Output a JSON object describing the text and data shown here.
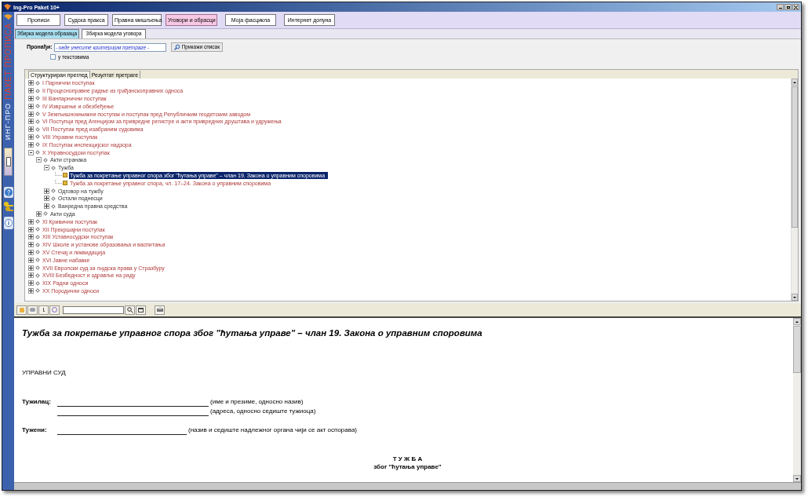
{
  "window": {
    "title": "Ing-Pro Paket 10+"
  },
  "sidebar": {
    "brand_top": "ПАКЕТ ПРОПИСА",
    "brand_bottom": "ИНГ-ПРО"
  },
  "tabs": [
    {
      "label": "Прописи",
      "selected": false
    },
    {
      "label": "Судска пракса",
      "selected": false
    },
    {
      "label": "Правна мишљења",
      "selected": false
    },
    {
      "label": "Уговори и обрасци",
      "selected": true
    },
    {
      "label": "Моја фасцикла",
      "selected": false
    },
    {
      "label": "Интернет допуна",
      "selected": false
    }
  ],
  "subtabs": [
    {
      "label": "Збирка модела образаца",
      "selected": true
    },
    {
      "label": "Збирка модела уговора",
      "selected": false
    }
  ],
  "search": {
    "label": "Пронађи:",
    "placeholder": "- овде унесите критеријум претраге -",
    "button": "Прикажи списак",
    "checkbox_label": "у текстовима",
    "checked": false
  },
  "tree_tabs": [
    {
      "label": "Структуриран преглед",
      "selected": true
    },
    {
      "label": "Резултат претраге",
      "selected": false
    }
  ],
  "tree": [
    {
      "kind": "section",
      "label": "I Парнични поступак",
      "expanded": false,
      "selected": false
    },
    {
      "kind": "section",
      "label": "II  Процесноправне радње из грађанскоправних односа",
      "expanded": false,
      "selected": false
    },
    {
      "kind": "section",
      "label": "III Ванпарнични поступак",
      "expanded": false,
      "selected": false
    },
    {
      "kind": "section",
      "label": "IV Извршење и обезбеђење",
      "expanded": false,
      "selected": false
    },
    {
      "kind": "section",
      "label": "V Земљишнокњижни поступак и поступак пред Републичким геодетским заводом",
      "expanded": false,
      "selected": false
    },
    {
      "kind": "section",
      "label": "VI Поступци пред Агенцијом за привредне регистре и акти привредних друштава и удружења",
      "expanded": false,
      "selected": false
    },
    {
      "kind": "section",
      "label": "VII Поступак пред изабраним судовима",
      "expanded": false,
      "selected": false
    },
    {
      "kind": "section",
      "label": "VIII Управни поступак",
      "expanded": false,
      "selected": false
    },
    {
      "kind": "section",
      "label": "IX Поступак инспекцијског надзора",
      "expanded": false,
      "selected": false
    },
    {
      "kind": "section",
      "label": "X Управносудски поступак",
      "expanded": true,
      "selected": false,
      "children": [
        {
          "kind": "folder",
          "label": "Акти странака",
          "expanded": true,
          "selected": false,
          "children": [
            {
              "kind": "folder",
              "label": "Тужба",
              "expanded": true,
              "selected": false,
              "children": [
                {
                  "kind": "document",
                  "label": "Тужба за покретање управног спора због \"ћутања управе\" – члан 19. Закона о управним споровима",
                  "selected": true
                },
                {
                  "kind": "document",
                  "label": "Тужба за покретање управног спора, чл. 17–24. Закона о управним споровима",
                  "selected": false
                }
              ]
            },
            {
              "kind": "folder",
              "label": "Одговор на тужбу",
              "expanded": false,
              "selected": false
            },
            {
              "kind": "folder",
              "label": "Остали поднесци",
              "expanded": false,
              "selected": false
            },
            {
              "kind": "folder",
              "label": "Ванредна правна средства",
              "expanded": false,
              "selected": false
            }
          ]
        },
        {
          "kind": "folder",
          "label": "Акти суда",
          "expanded": false,
          "selected": false
        }
      ]
    },
    {
      "kind": "section",
      "label": "XI Кривични поступак",
      "expanded": false,
      "selected": false
    },
    {
      "kind": "section",
      "label": "XII Прекршајни поступак",
      "expanded": false,
      "selected": false
    },
    {
      "kind": "section",
      "label": "XIII Уставносудски поступак",
      "expanded": false,
      "selected": false
    },
    {
      "kind": "section",
      "label": "XIV Школе и установе образовања и васпитања",
      "expanded": false,
      "selected": false
    },
    {
      "kind": "section",
      "label": "XV Стечај и ликвидација",
      "expanded": false,
      "selected": false
    },
    {
      "kind": "section",
      "label": "XVI Јавне набавке",
      "expanded": false,
      "selected": false
    },
    {
      "kind": "section",
      "label": "XVII Европски суд за људска права у Стразбуру",
      "expanded": false,
      "selected": false
    },
    {
      "kind": "section",
      "label": "XVIII Безбедност и здравље на раду",
      "expanded": false,
      "selected": false
    },
    {
      "kind": "section",
      "label": "XIX Радни односи",
      "expanded": false,
      "selected": false
    },
    {
      "kind": "section",
      "label": "XX Породични односи",
      "expanded": false,
      "selected": false
    }
  ],
  "document": [
    {
      "kind": "title",
      "text": "Тужба за покретање управног спора због \"ћутања управе\" – члан 19. Закона о управним споровима"
    },
    {
      "kind": "plain",
      "text": "УПРАВНИ СУД"
    },
    {
      "kind": "party",
      "label": "Тужилац:",
      "note": "(име и презиме, односно назив)"
    },
    {
      "kind": "continuation",
      "note": "(адреса, односно седиште тужиоца)"
    },
    {
      "kind": "party_short",
      "label": "Тужени:",
      "note": "(назив и седиште надлежног органа чији се акт оспорава)"
    },
    {
      "kind": "center",
      "text": "Т У Ж Б А"
    },
    {
      "kind": "center",
      "text": "због \"ћутања управе\""
    }
  ]
}
